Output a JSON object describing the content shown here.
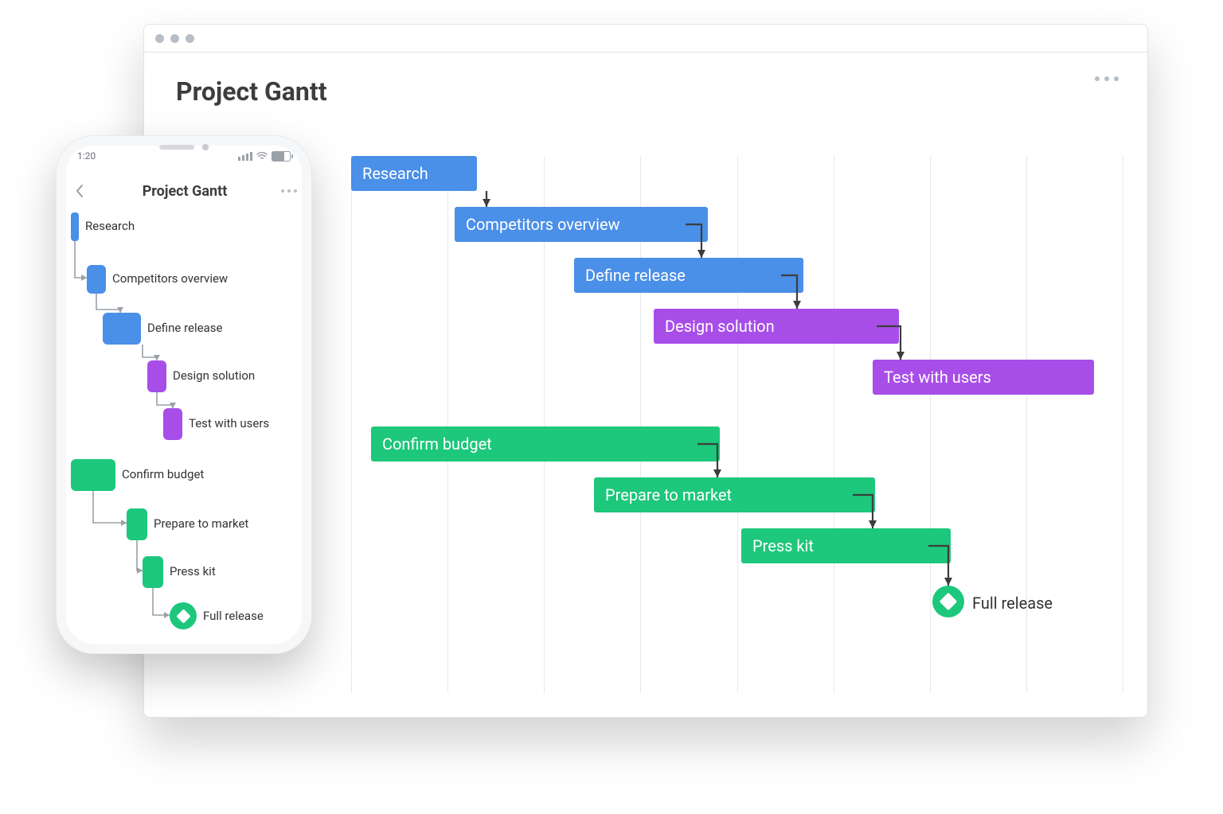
{
  "title": "Project Gantt",
  "phone": {
    "time": "1:20",
    "title": "Project Gantt"
  },
  "colors": {
    "blue": "#4a8fe8",
    "purple": "#a84ee8",
    "green": "#1dc77b"
  },
  "tasks": [
    {
      "id": "research",
      "label": "Research",
      "color": "blue"
    },
    {
      "id": "competitors",
      "label": "Competitors overview",
      "color": "blue"
    },
    {
      "id": "define-release",
      "label": "Define release",
      "color": "blue"
    },
    {
      "id": "design-solution",
      "label": "Design solution",
      "color": "purple"
    },
    {
      "id": "test-users",
      "label": "Test with users",
      "color": "purple"
    },
    {
      "id": "confirm-budget",
      "label": "Confirm budget",
      "color": "green"
    },
    {
      "id": "prepare-market",
      "label": "Prepare to market",
      "color": "green"
    },
    {
      "id": "press-kit",
      "label": "Press kit",
      "color": "green"
    }
  ],
  "milestone": {
    "id": "full-release",
    "label": "Full release"
  },
  "chart_data": {
    "type": "bar",
    "title": "Project Gantt",
    "xlabel": "",
    "ylabel": "",
    "xlim": [
      0,
      8
    ],
    "series": [
      {
        "name": "Research",
        "start": 0.0,
        "end": 1.1,
        "group": "blue",
        "depends_on": null
      },
      {
        "name": "Competitors overview",
        "start": 1.1,
        "end": 3.6,
        "group": "blue",
        "depends_on": "Research"
      },
      {
        "name": "Define release",
        "start": 2.4,
        "end": 4.6,
        "group": "blue",
        "depends_on": "Competitors overview"
      },
      {
        "name": "Design solution",
        "start": 3.2,
        "end": 5.6,
        "group": "purple",
        "depends_on": "Define release"
      },
      {
        "name": "Test with users",
        "start": 5.6,
        "end": 7.7,
        "group": "purple",
        "depends_on": "Design solution"
      },
      {
        "name": "Confirm budget",
        "start": 0.2,
        "end": 3.7,
        "group": "green",
        "depends_on": null
      },
      {
        "name": "Prepare to market",
        "start": 2.6,
        "end": 5.4,
        "group": "green",
        "depends_on": "Confirm budget"
      },
      {
        "name": "Press kit",
        "start": 4.2,
        "end": 6.2,
        "group": "green",
        "depends_on": "Prepare to market"
      }
    ],
    "milestones": [
      {
        "name": "Full release",
        "at": 6.4,
        "depends_on": "Press kit"
      }
    ]
  }
}
